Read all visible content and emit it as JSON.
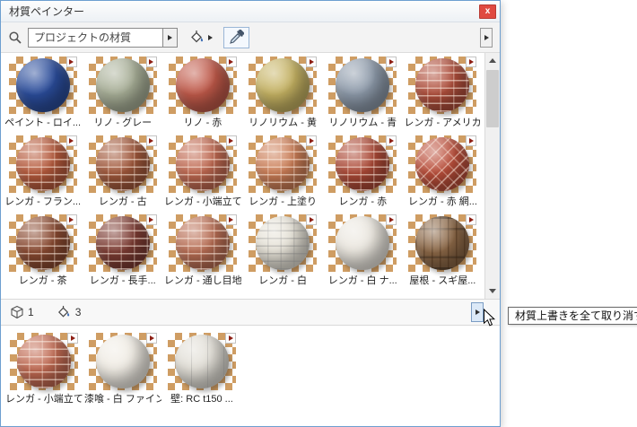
{
  "dialog": {
    "title": "材質ペインター",
    "close_label": "x"
  },
  "toolbar": {
    "search_value": "プロジェクトの材質"
  },
  "library": {
    "materials": [
      {
        "label": "ペイント - ロイ...",
        "color": "#2b4d9c",
        "pattern": "solid"
      },
      {
        "label": "リノ - グレー",
        "color": "#a9b098",
        "pattern": "solid"
      },
      {
        "label": "リノ - 赤",
        "color": "#c15a4a",
        "pattern": "solid"
      },
      {
        "label": "リノリウム - 黄",
        "color": "#c6b363",
        "pattern": "solid"
      },
      {
        "label": "リノリウム - 青",
        "color": "#8e9bab",
        "pattern": "solid"
      },
      {
        "label": "レンガ - アメリカ...",
        "color": "#b04f3c",
        "pattern": "brick"
      },
      {
        "label": "レンガ - フラン...",
        "color": "#b75b3d",
        "pattern": "brick"
      },
      {
        "label": "レンガ - 古",
        "color": "#a2593c",
        "pattern": "brick"
      },
      {
        "label": "レンガ - 小端立て",
        "color": "#c16a52",
        "pattern": "brick"
      },
      {
        "label": "レンガ - 上塗り",
        "color": "#cc7e57",
        "pattern": "brick"
      },
      {
        "label": "レンガ - 赤",
        "color": "#ad4a37",
        "pattern": "brick"
      },
      {
        "label": "レンガ - 赤 網...",
        "color": "#bb4f3b",
        "pattern": "brick-diag"
      },
      {
        "label": "レンガ - 茶",
        "color": "#8a4a31",
        "pattern": "brick"
      },
      {
        "label": "レンガ - 長手...",
        "color": "#7d3c33",
        "pattern": "brick"
      },
      {
        "label": "レンガ - 通し目地",
        "color": "#b96e54",
        "pattern": "brick"
      },
      {
        "label": "レンガ - 白",
        "color": "#e7e3d8",
        "pattern": "brick-light"
      },
      {
        "label": "レンガ - 白 ナ...",
        "color": "#ebe7df",
        "pattern": "solid"
      },
      {
        "label": "屋根 - スギ屋...",
        "color": "#8c6847",
        "pattern": "wood"
      }
    ]
  },
  "status": {
    "surface_count": "1",
    "bucket_count": "3"
  },
  "applied": {
    "materials": [
      {
        "label": "レンガ - 小端立て",
        "color": "#c16a52",
        "pattern": "brick"
      },
      {
        "label": "漆喰 - 白 ファイン",
        "color": "#f0ece4",
        "pattern": "solid"
      },
      {
        "label": "壁: RC t150 ...",
        "color": "#e2dfd7",
        "pattern": "concrete"
      }
    ]
  },
  "tooltip": {
    "text": "材質上書きを全て取り消す"
  },
  "colors": {
    "checker_tan": "#cf9d63",
    "window_border": "#6d9fd0",
    "close_red": "#e04a41",
    "corner_marker": "#8d1f14"
  }
}
